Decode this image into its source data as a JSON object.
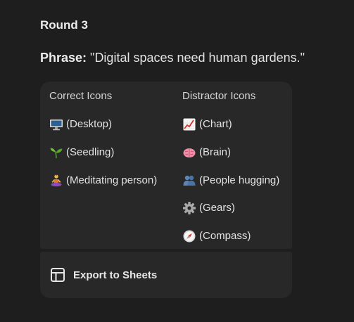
{
  "round": {
    "title": "Round 3"
  },
  "phrase": {
    "label": "Phrase:",
    "text": " \"Digital spaces need human gardens.\""
  },
  "correct": {
    "header": "Correct Icons",
    "items": [
      {
        "icon": "desktop-icon",
        "label": "(Desktop)"
      },
      {
        "icon": "seedling-icon",
        "label": "(Seedling)"
      },
      {
        "icon": "meditating-person-icon",
        "label": "(Meditating person)"
      }
    ]
  },
  "distractors": {
    "header": "Distractor Icons",
    "items": [
      {
        "icon": "chart-icon",
        "label": "(Chart)"
      },
      {
        "icon": "brain-icon",
        "label": "(Brain)"
      },
      {
        "icon": "people-hugging-icon",
        "label": "(People hugging)"
      },
      {
        "icon": "gears-icon",
        "label": "(Gears)"
      },
      {
        "icon": "compass-icon",
        "label": "(Compass)"
      }
    ]
  },
  "export": {
    "label": "Export to Sheets",
    "icon": "sheets-table-icon"
  },
  "colors": {
    "background": "#1e1e1e",
    "card": "#282828",
    "text": "#e3e3e3"
  }
}
